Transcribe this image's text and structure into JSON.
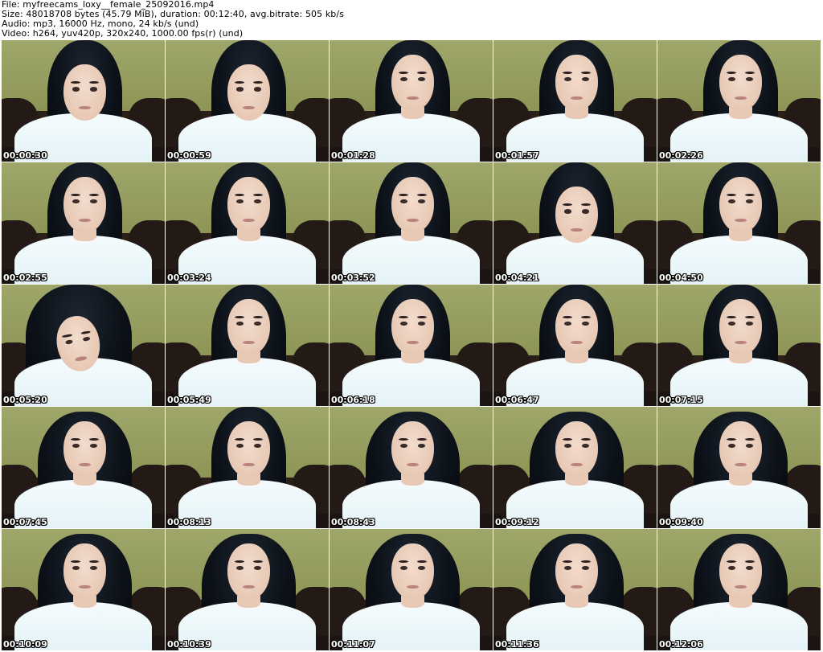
{
  "header": {
    "line1": "File: myfreecams_loxy__female_25092016.mp4",
    "line2": "Size: 48018708 bytes (45.79 MiB), duration: 00:12:40, avg.bitrate: 505 kb/s",
    "line3": "Audio: mp3, 16000 Hz, mono, 24 kb/s (und)",
    "line4": "Video: h264, yuv420p, 320x240, 1000.00 fps(r) (und)"
  },
  "thumbnails": [
    {
      "timestamp": "00:00:30",
      "variant": "down"
    },
    {
      "timestamp": "00:00:59",
      "variant": "down"
    },
    {
      "timestamp": "00:01:28",
      "variant": ""
    },
    {
      "timestamp": "00:01:57",
      "variant": ""
    },
    {
      "timestamp": "00:02:26",
      "variant": ""
    },
    {
      "timestamp": "00:02:55",
      "variant": ""
    },
    {
      "timestamp": "00:03:24",
      "variant": ""
    },
    {
      "timestamp": "00:03:52",
      "variant": ""
    },
    {
      "timestamp": "00:04:21",
      "variant": "down"
    },
    {
      "timestamp": "00:04:50",
      "variant": ""
    },
    {
      "timestamp": "00:05:20",
      "variant": "lean"
    },
    {
      "timestamp": "00:05:49",
      "variant": ""
    },
    {
      "timestamp": "00:06:18",
      "variant": ""
    },
    {
      "timestamp": "00:06:47",
      "variant": ""
    },
    {
      "timestamp": "00:07:15",
      "variant": ""
    },
    {
      "timestamp": "00:07:45",
      "variant": "dark"
    },
    {
      "timestamp": "00:08:13",
      "variant": ""
    },
    {
      "timestamp": "00:08:43",
      "variant": "dark"
    },
    {
      "timestamp": "00:09:12",
      "variant": "dark"
    },
    {
      "timestamp": "00:09:40",
      "variant": "dark"
    },
    {
      "timestamp": "00:10:09",
      "variant": "dark"
    },
    {
      "timestamp": "00:10:39",
      "variant": "dark"
    },
    {
      "timestamp": "00:11:07",
      "variant": "dark"
    },
    {
      "timestamp": "00:11:36",
      "variant": "dark"
    },
    {
      "timestamp": "00:12:06",
      "variant": "dark"
    }
  ]
}
